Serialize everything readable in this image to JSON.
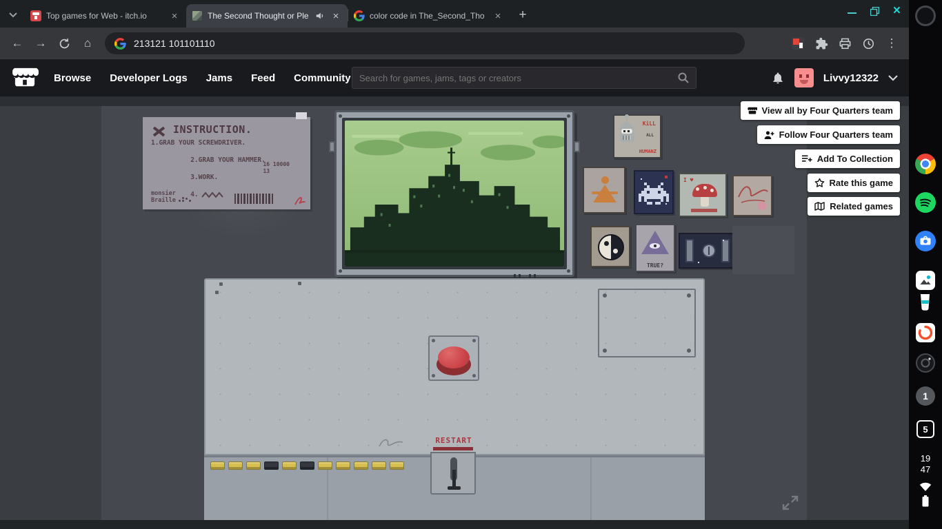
{
  "icons": {
    "back": "←",
    "forward": "→",
    "home": "⌂",
    "kebab": "⋮",
    "close": "×",
    "new_tab": "+"
  },
  "tabs": [
    {
      "title": "Top games for Web - itch.io"
    },
    {
      "title": "The Second Thought or Ple"
    },
    {
      "title": "color code in The_Second_Tho"
    }
  ],
  "omnibox": {
    "url": "213121 101101110"
  },
  "itch": {
    "nav": [
      "Browse",
      "Developer Logs",
      "Jams",
      "Feed",
      "Community"
    ],
    "search_placeholder": "Search for games, jams, tags or creators",
    "username": "Livvy12322"
  },
  "overlay": [
    {
      "label": "View all by Four Quarters team"
    },
    {
      "label": "Follow Four Quarters team"
    },
    {
      "label": "Add To Collection"
    },
    {
      "label": "Rate this game"
    },
    {
      "label": "Related games"
    }
  ],
  "game": {
    "instruction": {
      "title": "INSTRUCTION.",
      "line1": "1.GRAB YOUR SCREWDRIVER.",
      "line2": "2.GRAB YOUR HAMMER.",
      "line3": "3.WORK.",
      "line4": "4.",
      "numbers1": "16 10000",
      "numbers2": "13",
      "footer1": "monsier",
      "footer2": "Braille"
    },
    "posters": {
      "bender1": "KiLL",
      "bender2": "ALL",
      "bender3": "HUMANZ",
      "pyramid": "TRUE?",
      "iheart": "I ♥"
    },
    "restart": "RESTART",
    "tokens": [
      "gold",
      "gold",
      "gold",
      "dark",
      "gold",
      "dark",
      "gold",
      "gold",
      "gold",
      "gold",
      "gold"
    ],
    "sprites": {
      "invader": [
        "00100000100",
        "00010001000",
        "00111111100",
        "01101110110",
        "11111111111",
        "10111111101",
        "10100000101",
        "00011011000"
      ]
    }
  },
  "shelf": {
    "hour": "19",
    "minute": "47",
    "badge_one": "1",
    "badge_five": "5"
  }
}
